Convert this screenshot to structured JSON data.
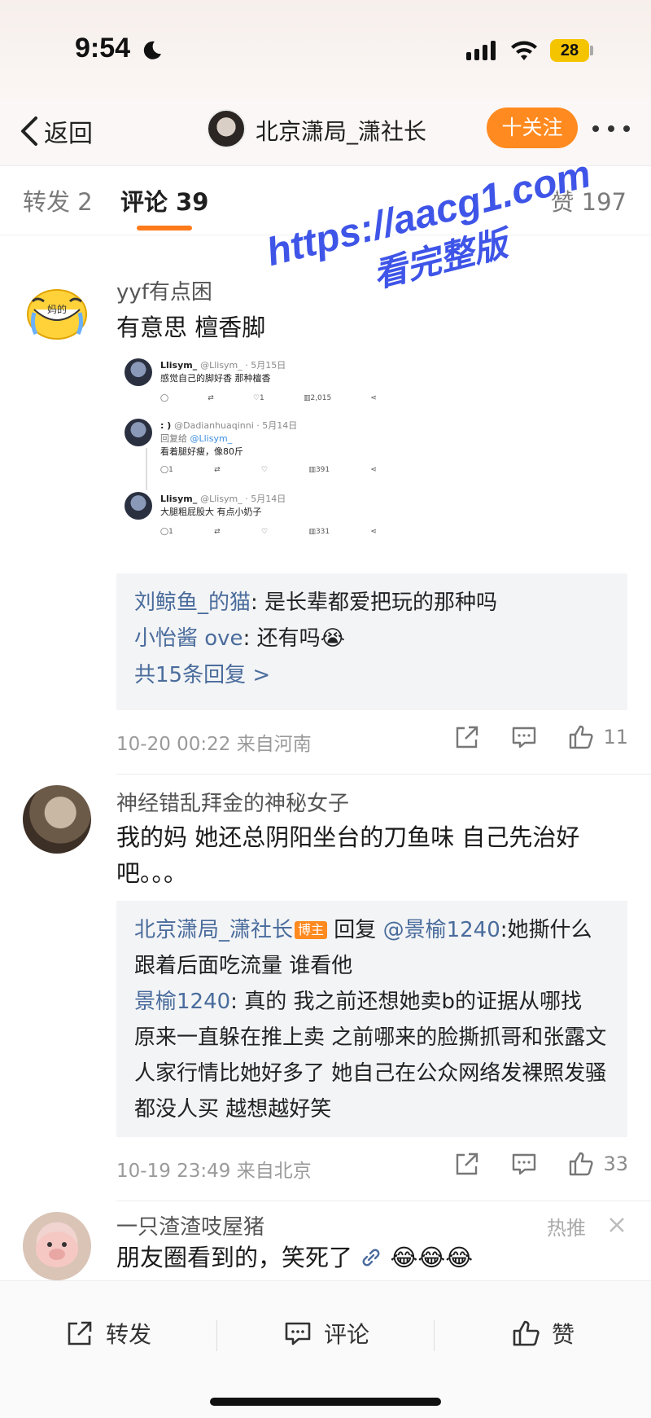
{
  "status_bar": {
    "time": "9:54",
    "battery": "28"
  },
  "nav": {
    "back_label": "返回",
    "title": "北京潇局_潇社长",
    "follow_label": "十关注"
  },
  "tabs": {
    "repost": "转发 2",
    "comment": "评论 39",
    "like": "赞 197"
  },
  "comments": [
    {
      "user": "yyf有点困",
      "text": "有意思 檀香脚",
      "embed": {
        "tweets": [
          {
            "name": "Llisym_",
            "handle": "@Llisym_ · 5月15日",
            "reply_to": "",
            "body": "感觉自己的脚好香 那种檀香",
            "stats": [
              "",
              "",
              "1",
              "2,015",
              ""
            ]
          },
          {
            "name": ": )",
            "handle": "@Dadianhuaqinni · 5月14日",
            "reply_to_prefix": "回复给 ",
            "reply_to": "@Llisym_",
            "body": "看着腿好瘦，像80斤",
            "stats": [
              "1",
              "",
              "",
              "391",
              ""
            ]
          },
          {
            "name": "Llisym_",
            "handle": "@Llisym_ · 5月14日",
            "reply_to": "",
            "body": "大腿粗屁股大 有点小奶子",
            "stats": [
              "1",
              "",
              "",
              "331",
              ""
            ]
          }
        ]
      },
      "replies": [
        {
          "user": "刘鲸鱼_的猫",
          "text": ": 是长辈都爱把玩的那种吗"
        },
        {
          "user": "小怡酱 ove",
          "text": ": 还有吗😭"
        }
      ],
      "reply_count": "共15条回复 >",
      "time": "10-20 00:22",
      "location": "来自河南",
      "likes": "11"
    },
    {
      "user": "神经错乱拜金的神秘女子",
      "text": "我的妈 她还总阴阳坐台的刀鱼味 自己先治好吧。。。",
      "replies": [
        {
          "user": "北京潇局_潇社长",
          "badge": "博主",
          "text": " 回复 ",
          "mention": "@景榆1240",
          "text2": ":她撕什么 跟着后面吃流量 谁看他"
        },
        {
          "user": "景榆1240",
          "text": ": 真的 我之前还想她卖b的证据从哪找 原来一直躲在推上卖  之前哪来的脸撕抓哥和张露文   人家行情比她好多了  她自己在公众网络发裸照发骚都没人买 越想越好笑"
        }
      ],
      "time": "10-19 23:49",
      "location": "来自北京",
      "likes": "33"
    },
    {
      "user": "一只渣渣吱屋猪",
      "text": "朋友圈看到的，笑死了",
      "emojis": "😂😂😂",
      "tag": "热推"
    }
  ],
  "watermark": {
    "url": "https://aacg1.com",
    "sub": "看完整版"
  },
  "bottom_bar": {
    "repost": "转发",
    "comment": "评论",
    "like": "赞"
  }
}
